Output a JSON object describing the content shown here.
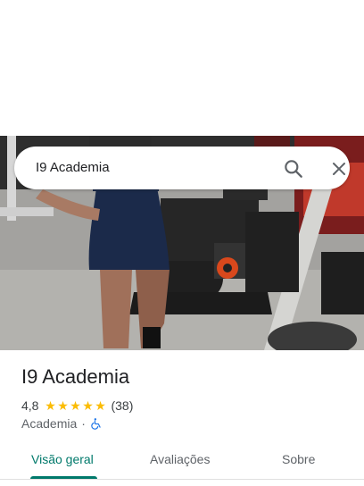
{
  "search": {
    "query": "I9 Academia"
  },
  "place": {
    "name": "I9 Academia",
    "rating": "4,8",
    "stars": [
      "★",
      "★",
      "★",
      "★",
      "★"
    ],
    "review_count": "(38)",
    "category": "Academia",
    "separator": "·",
    "wheelchair_accessible": true
  },
  "tabs": [
    {
      "label": "Visão geral",
      "active": true
    },
    {
      "label": "Avaliações",
      "active": false
    },
    {
      "label": "Sobre",
      "active": false
    }
  ],
  "colors": {
    "accent": "#00796b",
    "star": "#fbbc04"
  },
  "icons": {
    "search": "search-icon",
    "close": "close-icon",
    "accessibility": "wheelchair-icon"
  }
}
